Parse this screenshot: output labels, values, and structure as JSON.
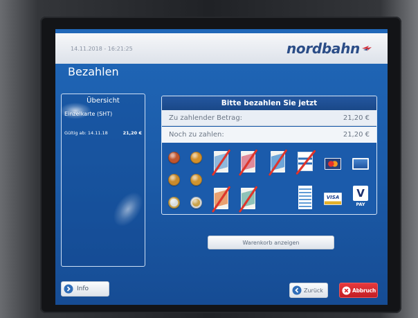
{
  "header": {
    "datetime": "14.11.2018 - 16:21:25",
    "brand": "nordbahn"
  },
  "page_title": "Bezahlen",
  "overview": {
    "title": "Übersicht",
    "item": "Einzelkarte (SHT)",
    "valid_label": "Gültig ab: 14.11.18",
    "price": "21,20 €"
  },
  "payment": {
    "title": "Bitte bezahlen Sie jetzt",
    "amount_due_label": "Zu zahlender Betrag:",
    "amount_due": "21,20 €",
    "remaining_label": "Noch zu zahlen:",
    "remaining": "21,20 €",
    "methods": [
      {
        "icon": "coin-icon",
        "color": "#c0552e",
        "accepted": true
      },
      {
        "icon": "coin-icon",
        "color": "#d4902a",
        "accepted": true
      },
      {
        "icon": "coin-icon",
        "color": "#c98a2c",
        "accepted": true
      },
      {
        "icon": "coin-icon",
        "color": "#cf9430",
        "accepted": true
      },
      {
        "icon": "coin-icon",
        "color": "#c9a24a",
        "inner_color": "#d8dcdf",
        "accepted": true
      },
      {
        "icon": "coin-icon",
        "color": "#d8dcdf",
        "inner_color": "#c9a24a",
        "accepted": true
      },
      {
        "icon": "banknote-icon",
        "color": "#8fb8dc",
        "accepted": false
      },
      {
        "icon": "banknote-icon",
        "color": "#e08a9a",
        "accepted": false
      },
      {
        "icon": "banknote-icon",
        "color": "#6fa6d8",
        "accepted": false
      },
      {
        "icon": "banknote-icon",
        "color": "#e8a070",
        "accepted": false
      },
      {
        "icon": "banknote-icon",
        "color": "#8fc2b8",
        "accepted": false
      },
      {
        "icon": "ec-card-icon",
        "accepted": false
      },
      {
        "icon": "maestro-card-icon",
        "accepted": true
      },
      {
        "icon": "credit-card-icon",
        "accepted": true
      },
      {
        "icon": "geldkarte-icon",
        "accepted": true
      },
      {
        "icon": "visa-card-icon",
        "label": "VISA",
        "accepted": true
      },
      {
        "icon": "vpay-card-icon",
        "label": "V",
        "sublabel": "PAY",
        "accepted": true
      }
    ]
  },
  "buttons": {
    "cart": "Warenkorb anzeigen",
    "info": "Info",
    "back": "Zurück",
    "cancel": "Abbruch"
  },
  "colors": {
    "screen_blue": "#1b5aa7",
    "cancel_red": "#d8262b",
    "not_accepted_strike": "#e2342b",
    "brand_blue": "#2b4d87"
  }
}
